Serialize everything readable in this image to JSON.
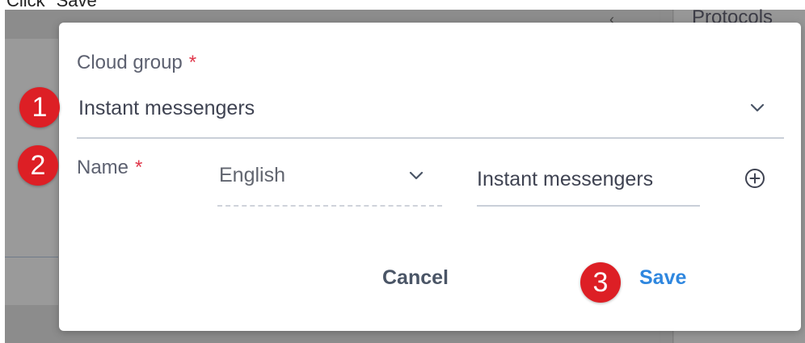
{
  "caption": "Click \"Save\"",
  "background": {
    "right_panel_title": "Protocols"
  },
  "dialog": {
    "cloud_group": {
      "label": "Cloud group",
      "required_mark": "*",
      "value": "Instant messengers"
    },
    "name": {
      "label": "Name",
      "required_mark": "*",
      "language": "English",
      "value": "Instant messengers"
    },
    "buttons": {
      "cancel": "Cancel",
      "save": "Save"
    }
  },
  "steps": [
    "1",
    "2",
    "3"
  ],
  "colors": {
    "accent": "#2f87df",
    "step_marker": "#dd1f25",
    "required": "#e0364a"
  }
}
